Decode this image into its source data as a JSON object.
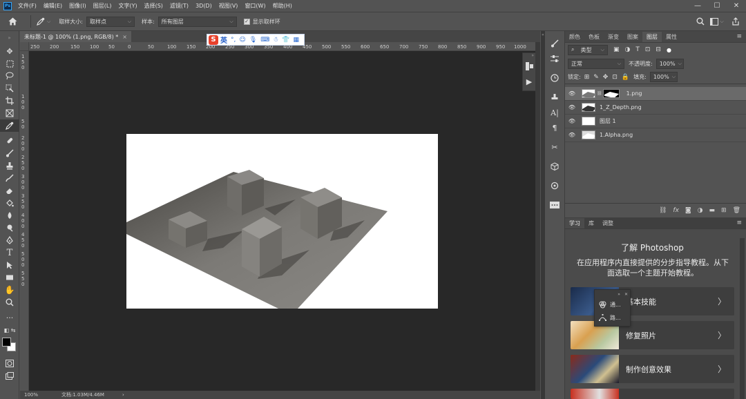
{
  "menubar": {
    "logo": "Ps",
    "items": [
      "文件(F)",
      "编辑(E)",
      "图像(I)",
      "图层(L)",
      "文字(Y)",
      "选择(S)",
      "滤镜(T)",
      "3D(D)",
      "视图(V)",
      "窗口(W)",
      "帮助(H)"
    ],
    "window_controls": {
      "minimize": "—",
      "maximize": "☐",
      "close": "✕"
    }
  },
  "options_bar": {
    "sample_size_label": "取样大小:",
    "sample_size_value": "取样点",
    "sample_label": "样本:",
    "sample_value": "所有图层",
    "show_ring_label": "显示取样环",
    "show_ring_checked": true
  },
  "document": {
    "tab_title": "未标题-1 @ 100% (1.png, RGB/8) *",
    "close": "×",
    "ruler_h": [
      "250",
      "200",
      "150",
      "100",
      "50",
      "0",
      "50",
      "100",
      "150",
      "200",
      "250",
      "300",
      "350",
      "400",
      "450",
      "500",
      "550",
      "600",
      "650",
      "700",
      "750",
      "800",
      "850",
      "900",
      "950",
      "1000"
    ],
    "ruler_v": [
      "1",
      "5",
      "0",
      "1",
      "0",
      "0",
      "5",
      "0",
      "2",
      "0",
      "0",
      "2",
      "5",
      "0",
      "3",
      "0",
      "0",
      "3",
      "5",
      "0",
      "4",
      "0",
      "0",
      "4",
      "5",
      "0",
      "5",
      "0",
      "0",
      "5",
      "5",
      "0"
    ],
    "status_zoom": "100%",
    "status_doc": "文档:1.03M/4.46M",
    "status_arrow": "›"
  },
  "ime_toolbar": {
    "logo": "S",
    "label": "英",
    "icons": [
      "moon-comma",
      "emoji",
      "mic",
      "keyboard",
      "skin",
      "shirt",
      "grid"
    ]
  },
  "panels": {
    "top_tabs": [
      "颜色",
      "色板",
      "渐变",
      "图案",
      "图层",
      "属性"
    ],
    "active_tab": "图层",
    "filter_label": "类型",
    "blend_mode": "正常",
    "opacity_label": "不透明度:",
    "opacity_value": "100%",
    "lock_label": "锁定:",
    "fill_label": "填充:",
    "fill_value": "100%",
    "layers": [
      {
        "name": "1.png",
        "selected": true
      },
      {
        "name": "1_Z_Depth.png",
        "selected": false
      },
      {
        "name": "图层 1",
        "selected": false
      },
      {
        "name": "1.Alpha.png",
        "selected": false
      }
    ],
    "bottom_tabs": [
      "学习",
      "库",
      "调整"
    ],
    "bottom_active": "学习",
    "learn_title": "了解 Photoshop",
    "learn_desc": "在应用程序内直接提供的分步指导教程。从下面选取一个主题开始教程。",
    "cards": [
      "基本技能",
      "修复照片",
      "制作创意效果"
    ],
    "float_items": [
      "通...",
      "路..."
    ]
  },
  "colors": {
    "ps_blue": "#31a8ff",
    "canvas_bg": "#282828",
    "ui_bg": "#535353"
  }
}
